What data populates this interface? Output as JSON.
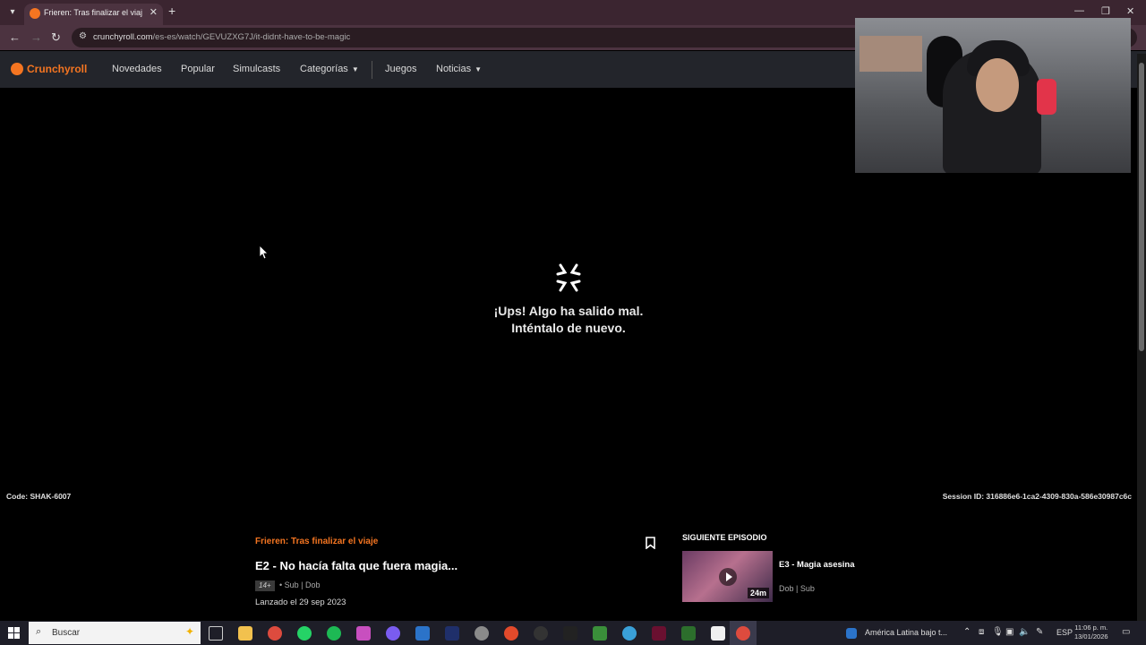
{
  "browser": {
    "tab_title": "Frieren: Tras finalizar el viaje N",
    "url_host": "crunchyroll.com",
    "url_path": "/es-es/watch/GEVUZXG7J/it-didnt-have-to-be-magic"
  },
  "site": {
    "logo": "Crunchyroll",
    "nav": [
      "Novedades",
      "Popular",
      "Simulcasts",
      "Categorías",
      "Juegos",
      "Noticias"
    ]
  },
  "error": {
    "line1": "¡Ups! Algo ha salido mal.",
    "line2": "Inténtalo de nuevo.",
    "code": "Code: SHAK-6007",
    "session": "Session ID: 316886e6-1ca2-4309-830a-586e30987c6c"
  },
  "episode": {
    "series": "Frieren: Tras finalizar el viaje",
    "title": "E2 - No hacía falta que fuera magia...",
    "rating": "14+",
    "audio": "• Sub | Dob",
    "released": "Lanzado el 29 sep 2023"
  },
  "next": {
    "heading": "SIGUIENTE EPISODIO",
    "title": "E3 - Magia asesina",
    "duration": "24m",
    "audio": "Dob | Sub"
  },
  "taskbar": {
    "search_placeholder": "Buscar",
    "news": "América Latina bajo t...",
    "lang": "ESP",
    "time": "11:06 p. m.",
    "date": "13/01/2026"
  }
}
